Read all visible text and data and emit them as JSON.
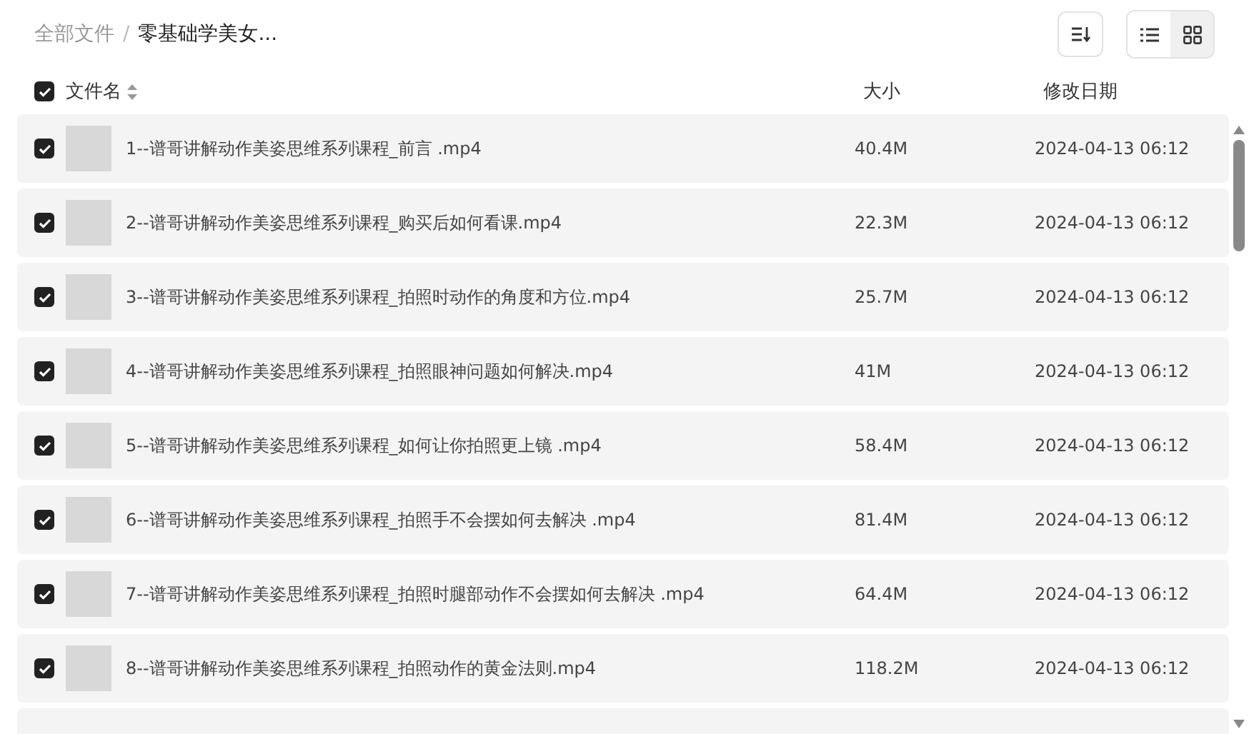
{
  "breadcrumb": [
    {
      "label": "全部文件",
      "current": false
    },
    {
      "separator": "/"
    },
    {
      "label": "零基础学美女...",
      "current": true
    }
  ],
  "toolbar": {
    "view_modes": [
      {
        "kind": "list",
        "selected": false
      },
      {
        "kind": "grid",
        "selected": true
      }
    ]
  },
  "header": {
    "checked": true,
    "columns": [
      "文件名",
      "大小",
      "修改日期"
    ]
  },
  "rows": [
    {
      "checked": true,
      "name": "1--谱哥讲解动作美姿思维系列课程_前言 .mp4",
      "size": "40.4M",
      "date": "2024-04-13 06:12"
    },
    {
      "checked": true,
      "name": "2--谱哥讲解动作美姿思维系列课程_购买后如何看课.mp4",
      "size": "22.3M",
      "date": "2024-04-13 06:12"
    },
    {
      "checked": true,
      "name": "3--谱哥讲解动作美姿思维系列课程_拍照时动作的角度和方位.mp4",
      "size": "25.7M",
      "date": "2024-04-13 06:12"
    },
    {
      "checked": true,
      "name": "4--谱哥讲解动作美姿思维系列课程_拍照眼神问题如何解决.mp4",
      "size": "41M",
      "date": "2024-04-13 06:12"
    },
    {
      "checked": true,
      "name": "5--谱哥讲解动作美姿思维系列课程_如何让你拍照更上镜 .mp4",
      "size": "58.4M",
      "date": "2024-04-13 06:12"
    },
    {
      "checked": true,
      "name": "6--谱哥讲解动作美姿思维系列课程_拍照手不会摆如何去解决 .mp4",
      "size": "81.4M",
      "date": "2024-04-13 06:12"
    },
    {
      "checked": true,
      "name": "7--谱哥讲解动作美姿思维系列课程_拍照时腿部动作不会摆如何去解决 .mp4",
      "size": "64.4M",
      "date": "2024-04-13 06:12"
    },
    {
      "checked": true,
      "name": "8--谱哥讲解动作美姿思维系列课程_拍照动作的黄金法则.mp4",
      "size": "118.2M",
      "date": "2024-04-13 06:12"
    }
  ]
}
